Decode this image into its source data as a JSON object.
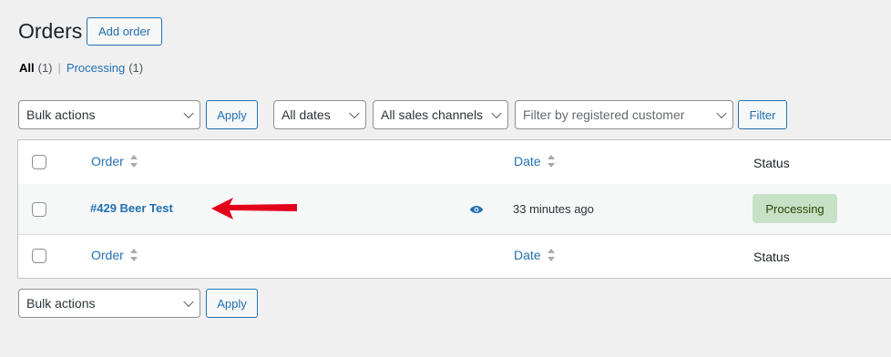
{
  "page": {
    "title": "Orders",
    "add_order_label": "Add order"
  },
  "views": [
    {
      "label": "All",
      "count": "(1)",
      "current": true
    },
    {
      "label": "Processing",
      "count": "(1)",
      "current": false
    }
  ],
  "views_separator": "|",
  "filters": {
    "bulk_actions": "Bulk actions",
    "apply_label": "Apply",
    "dates": "All dates",
    "sales_channels": "All sales channels",
    "customer_placeholder": "Filter by registered customer",
    "filter_label": "Filter"
  },
  "table": {
    "columns": {
      "order": "Order",
      "date": "Date",
      "status": "Status"
    },
    "rows": [
      {
        "order": "#429 Beer Test",
        "date": "33 minutes ago",
        "status": "Processing"
      }
    ]
  },
  "bottom": {
    "bulk_actions": "Bulk actions",
    "apply_label": "Apply"
  },
  "colors": {
    "link": "#2271b1",
    "status_processing_bg": "#c6e1c6",
    "status_processing_text": "#2c4700",
    "annotation_arrow": "#e3001b"
  },
  "icons": {
    "preview": "eye-icon",
    "annotation": "red-arrow-icon",
    "sort": "sort-arrows-icon",
    "dropdown": "chevron-down-icon"
  }
}
